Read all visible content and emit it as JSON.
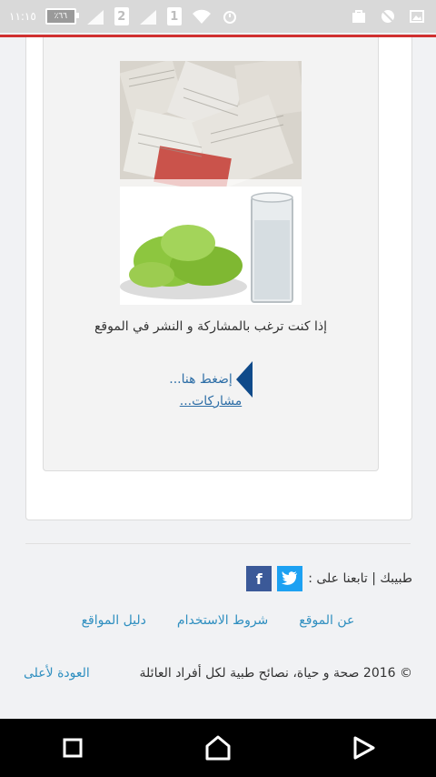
{
  "status_bar": {
    "time": "١١:١٥",
    "battery": "٪٦٦",
    "sim1": "2",
    "sim2": "1"
  },
  "promo": {
    "image_semantic": "books-water-lettuce-image",
    "text": "إذا كنت ترغب بالمشاركة و النشر في الموقع",
    "click_label": "إضغط هنا...",
    "posts_label": "مشاركات..."
  },
  "follow": {
    "label": "طبيبك | تابعنا على :",
    "twitter_icon": "twitter-icon",
    "facebook_icon": "facebook-icon",
    "twitter_color": "#1da1f2",
    "facebook_color": "#3b5998"
  },
  "footer_links": {
    "about": "عن الموقع",
    "terms": "شروط الاستخدام",
    "directory": "دليل المواقع"
  },
  "footer": {
    "copyright": "© 2016 صحة و حياة، نصائح طبية لكل أفراد العائلة",
    "back_to_top": "العودة لأعلى"
  },
  "colors": {
    "accent_red": "#d03030",
    "link_blue": "#2f8fc0",
    "arrow_blue": "#0f4a8a"
  }
}
